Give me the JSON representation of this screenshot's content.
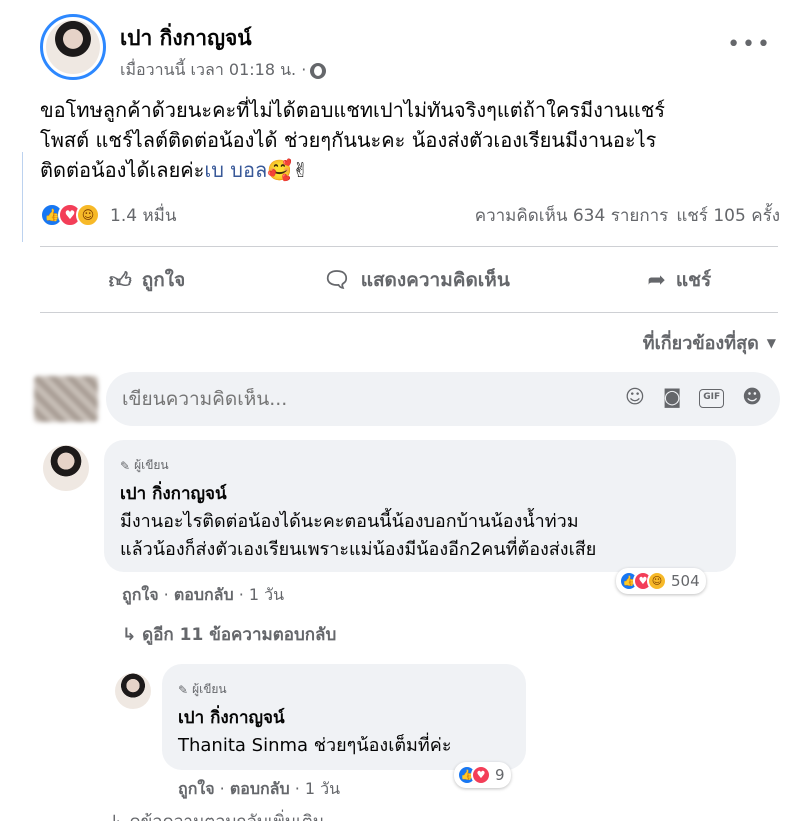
{
  "post": {
    "author": "เปา กิ่งกาญจน์",
    "time": "เมื่อวานนี้ เวลา 01:18 น. ·",
    "more_icon": "more-horizontal-icon",
    "text_lines": [
      "ขอโทษลูกค้าด้วยนะคะที่ไม่ได้ตอบแชทเปาไม่ทันจริงๆแต่ถ้าใครมีงานแชร์",
      "โพสต์ แชร์ไลต์ติดต่อน้องได้ ช่วยๆกันนะคะ น้องส่งตัวเองเรียนมีงานอะไร"
    ],
    "text_line3_prefix": "ติดต่อน้องได้เลยค่ะ",
    "mention": "เบ บอล",
    "emoji": "🥰✌"
  },
  "stats": {
    "reaction_count": "1.4 หมื่น",
    "comments": "ความคิดเห็น 634 รายการ",
    "shares": "แชร์ 105 ครั้ง"
  },
  "actions": {
    "like": "ถูกใจ",
    "comment": "แสดงความคิดเห็น",
    "share": "แชร์"
  },
  "sort": {
    "label": "ที่เกี่ยวข้องที่สุด"
  },
  "composer": {
    "placeholder": "เขียนความคิดเห็น..."
  },
  "comments": [
    {
      "tag": "ผู้เขียน",
      "author": "เปา กิ่งกาญจน์",
      "lines": [
        "มีงานอะไรติดต่อน้องได้นะคะตอนนี้น้องบอกบ้านน้องน้ำท่วม",
        "แล้วน้องก็ส่งตัวเองเรียนเพราะแม่น้องมีน้องอีก2คนที่ต้องส่งเสีย"
      ],
      "like": "ถูกใจ",
      "reply": "ตอบกลับ",
      "age": "1 วัน",
      "reaction_count": "504",
      "view_replies": "↳ ดูอีก 11 ข้อความตอบกลับ"
    },
    {
      "tag": "ผู้เขียน",
      "author": "เปา กิ่งกาญจน์",
      "lines": [
        "Thanita Sinma ช่วยๆน้องเต็มที่ค่ะ"
      ],
      "like": "ถูกใจ",
      "reply": "ตอบกลับ",
      "age": "1 วัน",
      "reaction_count": "9"
    }
  ],
  "cutoff_text": "↳ ดูข้อความตอบกลับเพิ่มเติม"
}
